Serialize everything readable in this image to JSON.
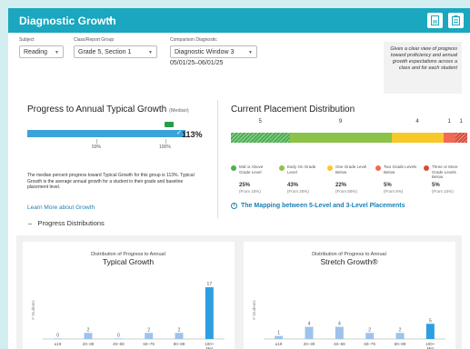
{
  "header": {
    "title": "Diagnostic Growth",
    "caret": "▾"
  },
  "filters": {
    "subject": {
      "label": "Subject",
      "value": "Reading"
    },
    "class_group": {
      "label": "Class/Report Group",
      "value": "Grade 5, Section 1"
    },
    "comparison": {
      "label": "Comparison Diagnostic",
      "value": "Diagnostic Window 3"
    },
    "date_range": "05/01/25–06/01/25"
  },
  "callout": "Gives a clear view of progress toward proficiency and annual growth expectations across a class and for each student",
  "progress": {
    "title": "Progress to Annual Typical Growth",
    "title_note": "(Median)",
    "value_label": "113%",
    "fill_fraction": 1.0,
    "tick_50_top": "|",
    "tick_50": "50%",
    "tick_100_top": "|",
    "tick_100": "100%",
    "description": "The median percent progress toward Typical Growth for this group is 113%. Typical Growth is the average annual growth for a student in their grade and baseline placement level.",
    "learn_more": "Learn More about Growth"
  },
  "placement": {
    "title": "Current Placement Distribution",
    "segments": [
      {
        "count": "5",
        "share": 0.25,
        "color": "#4caf50",
        "hatched": true
      },
      {
        "count": "9",
        "share": 0.43,
        "color": "#8bc34a",
        "hatched": false
      },
      {
        "count": "4",
        "share": 0.22,
        "color": "#f7c928",
        "hatched": false
      },
      {
        "count": "1",
        "share": 0.05,
        "color": "#f06a55",
        "hatched": false
      },
      {
        "count": "1",
        "share": 0.05,
        "color": "#d84a3a",
        "hatched": true
      }
    ],
    "legend": [
      {
        "label": "Mid or Above Grade Level",
        "pct": "25%",
        "prev": "(From 15%)",
        "color": "#4caf50"
      },
      {
        "label": "Early On Grade Level",
        "pct": "43%",
        "prev": "(From 20%)",
        "color": "#8bc34a"
      },
      {
        "label": "One Grade Level Below",
        "pct": "22%",
        "prev": "(From 50%)",
        "color": "#f7c928"
      },
      {
        "label": "Two Grade Levels Below",
        "pct": "5%",
        "prev": "(From 5%)",
        "color": "#f06a55"
      },
      {
        "label": "Three or More Grade Levels Below",
        "pct": "5%",
        "prev": "(From 10%)",
        "color": "#d84a3a"
      }
    ],
    "mapping_link": "The Mapping between 5-Level and 3-Level Placements",
    "info_glyph": "i"
  },
  "distributions": {
    "toggle": "–",
    "title": "Progress Distributions"
  },
  "chart_data": [
    {
      "type": "bar",
      "title": "Distribution of Progress to Annual",
      "subtitle": "Typical Growth",
      "ylabel": "# Students",
      "xlabel": "% Progress",
      "categories": [
        "≤19",
        "20–39",
        "40–59",
        "60–79",
        "80–99",
        "100+ Met"
      ],
      "values": [
        0,
        2,
        0,
        2,
        2,
        17
      ],
      "ylim": [
        0,
        20
      ],
      "color": "#9dc3ea",
      "highlight_color": "#2d9fe0"
    },
    {
      "type": "bar",
      "title": "Distribution of Progress to Annual",
      "subtitle": "Stretch Growth®",
      "ylabel": "# Students",
      "xlabel": "% Progress",
      "categories": [
        "≤19",
        "20–39",
        "40–59",
        "60–79",
        "80–99",
        "100+ Met"
      ],
      "values": [
        1,
        4,
        4,
        2,
        2,
        5
      ],
      "ylim": [
        0,
        20
      ],
      "color": "#9dc3ea",
      "highlight_color": "#2d9fe0"
    }
  ]
}
